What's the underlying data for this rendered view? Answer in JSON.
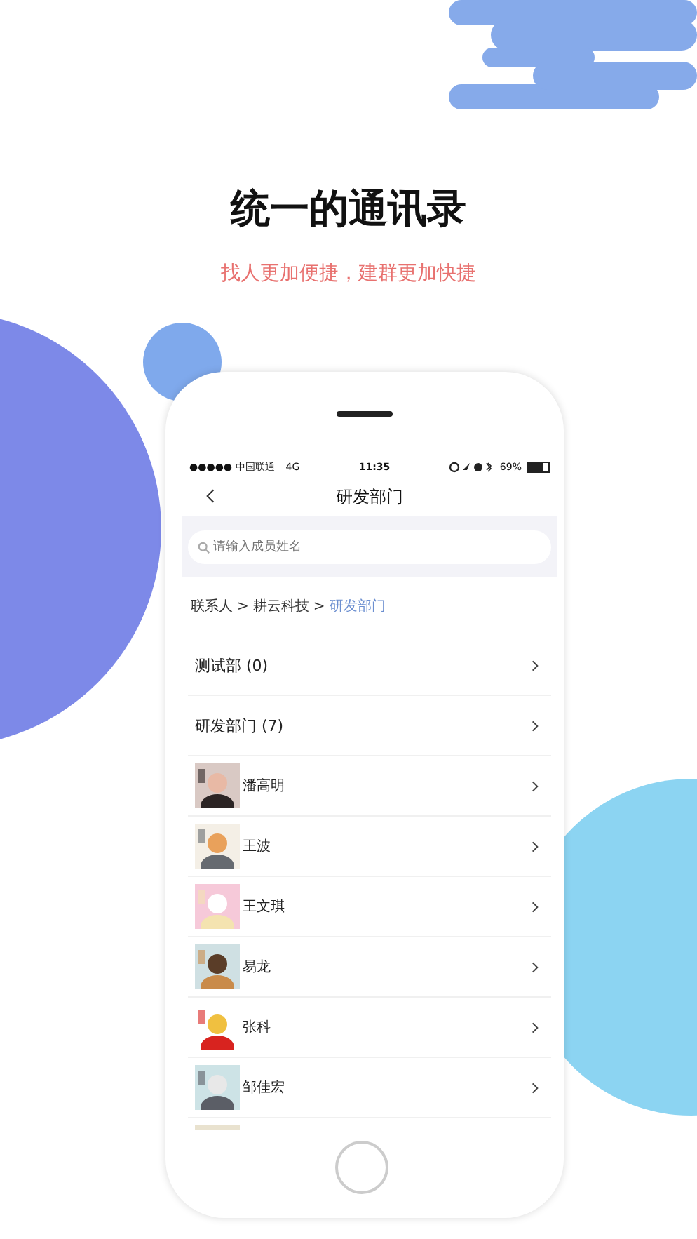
{
  "headline": "统一的通讯录",
  "subheadline": "找人更加便捷，建群更加快捷",
  "status_bar": {
    "carrier": "●●●●● 中国联通",
    "network": "4G",
    "time": "11:35",
    "battery": "69%"
  },
  "nav": {
    "title": "研发部门"
  },
  "search": {
    "placeholder": "请输入成员姓名"
  },
  "breadcrumb": [
    {
      "label": "联系人",
      "kind": "crumb",
      "selected": false
    },
    {
      "label": ">",
      "kind": "separator"
    },
    {
      "label": "耕云科技",
      "kind": "crumb",
      "selected": false
    },
    {
      "label": ">",
      "kind": "separator"
    },
    {
      "label": "研发部门",
      "kind": "crumb",
      "selected": true
    }
  ],
  "departments": [
    {
      "name": "测试部 (0)"
    },
    {
      "name": "研发部门 (7)"
    }
  ],
  "members": [
    {
      "name": "潘高明",
      "avatar": {
        "kind": "picture"
      }
    },
    {
      "name": "王波",
      "avatar": {
        "kind": "picture"
      }
    },
    {
      "name": "王文琪",
      "avatar": {
        "kind": "picture"
      }
    },
    {
      "name": "易龙",
      "avatar": {
        "kind": "picture"
      }
    },
    {
      "name": "张科",
      "avatar": {
        "kind": "picture"
      }
    },
    {
      "name": "邹佳宏",
      "avatar": {
        "kind": "picture"
      }
    },
    {
      "avatar": {
        "kind": "picture"
      }
    }
  ]
}
